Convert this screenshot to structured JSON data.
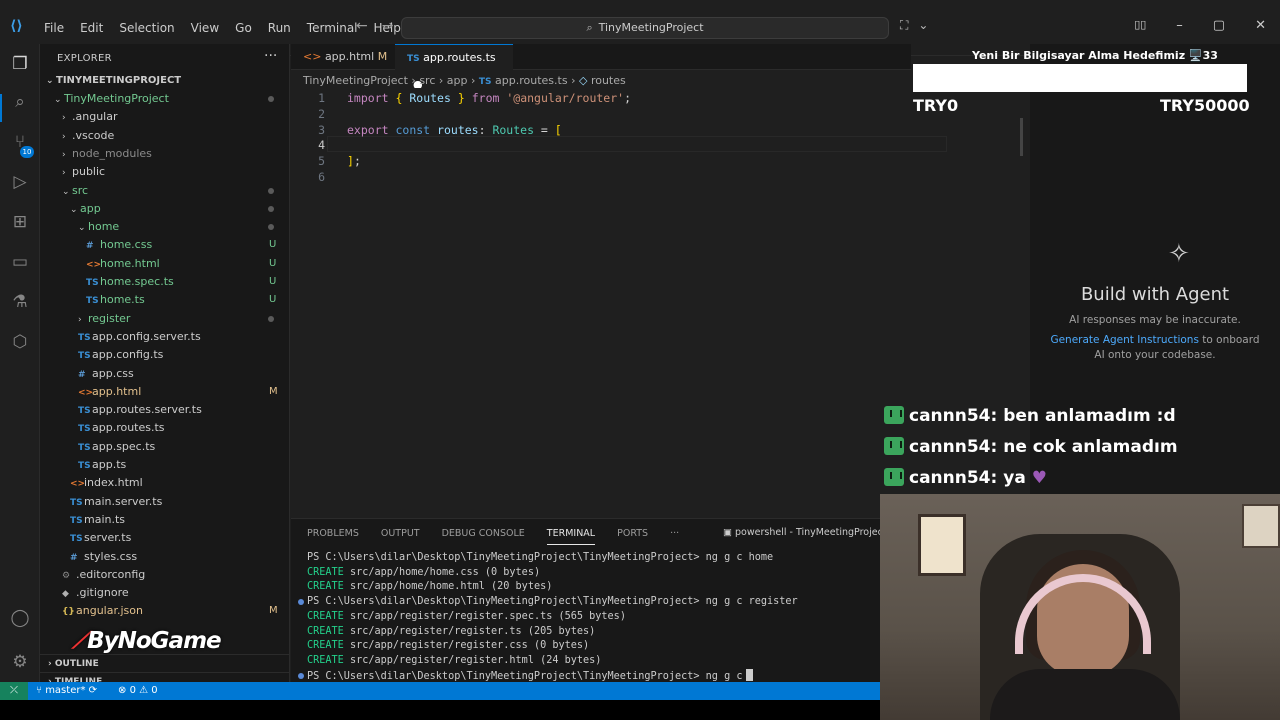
{
  "titlebar": {
    "menu": [
      "File",
      "Edit",
      "Selection",
      "View",
      "Go",
      "Run",
      "Terminal",
      "Help"
    ],
    "search": "TinyMeetingProject"
  },
  "sidebar": {
    "header": "EXPLORER",
    "project": "TINYMEETINGPROJECT",
    "items": [
      {
        "label": "TinyMeetingProject",
        "type": "folder",
        "open": true,
        "depth": 1,
        "icon": "",
        "status": "dot"
      },
      {
        "label": ".angular",
        "type": "folder",
        "open": false,
        "depth": 2,
        "icon": "",
        "status": ""
      },
      {
        "label": ".vscode",
        "type": "folder",
        "open": false,
        "depth": 2,
        "icon": "",
        "status": ""
      },
      {
        "label": "node_modules",
        "type": "folder",
        "open": false,
        "depth": 2,
        "icon": "",
        "status": "",
        "dim": true
      },
      {
        "label": "public",
        "type": "folder",
        "open": false,
        "depth": 2,
        "icon": "",
        "status": ""
      },
      {
        "label": "src",
        "type": "folder",
        "open": true,
        "depth": 2,
        "icon": "",
        "status": "dot"
      },
      {
        "label": "app",
        "type": "folder",
        "open": true,
        "depth": 3,
        "icon": "",
        "status": "dot"
      },
      {
        "label": "home",
        "type": "folder",
        "open": true,
        "depth": 4,
        "icon": "",
        "status": "dot"
      },
      {
        "label": "home.css",
        "type": "file",
        "depth": 5,
        "icon": "#",
        "kind": "css",
        "status": "U"
      },
      {
        "label": "home.html",
        "type": "file",
        "depth": 5,
        "icon": "<>",
        "kind": "htm",
        "status": "U"
      },
      {
        "label": "home.spec.ts",
        "type": "file",
        "depth": 5,
        "icon": "TS",
        "kind": "ts",
        "status": "U"
      },
      {
        "label": "home.ts",
        "type": "file",
        "depth": 5,
        "icon": "TS",
        "kind": "ts",
        "status": "U"
      },
      {
        "label": "register",
        "type": "folder",
        "open": false,
        "depth": 4,
        "icon": "",
        "status": "dot"
      },
      {
        "label": "app.config.server.ts",
        "type": "file",
        "depth": 4,
        "icon": "TS",
        "kind": "ts",
        "status": ""
      },
      {
        "label": "app.config.ts",
        "type": "file",
        "depth": 4,
        "icon": "TS",
        "kind": "ts",
        "status": ""
      },
      {
        "label": "app.css",
        "type": "file",
        "depth": 4,
        "icon": "#",
        "kind": "css",
        "status": ""
      },
      {
        "label": "app.html",
        "type": "file",
        "depth": 4,
        "icon": "<>",
        "kind": "htm",
        "status": "M"
      },
      {
        "label": "app.routes.server.ts",
        "type": "file",
        "depth": 4,
        "icon": "TS",
        "kind": "ts",
        "status": ""
      },
      {
        "label": "app.routes.ts",
        "type": "file",
        "depth": 4,
        "icon": "TS",
        "kind": "ts",
        "status": ""
      },
      {
        "label": "app.spec.ts",
        "type": "file",
        "depth": 4,
        "icon": "TS",
        "kind": "ts",
        "status": ""
      },
      {
        "label": "app.ts",
        "type": "file",
        "depth": 4,
        "icon": "TS",
        "kind": "ts",
        "status": ""
      },
      {
        "label": "index.html",
        "type": "file",
        "depth": 3,
        "icon": "<>",
        "kind": "htm",
        "status": ""
      },
      {
        "label": "main.server.ts",
        "type": "file",
        "depth": 3,
        "icon": "TS",
        "kind": "ts",
        "status": ""
      },
      {
        "label": "main.ts",
        "type": "file",
        "depth": 3,
        "icon": "TS",
        "kind": "ts",
        "status": ""
      },
      {
        "label": "server.ts",
        "type": "file",
        "depth": 3,
        "icon": "TS",
        "kind": "ts",
        "status": ""
      },
      {
        "label": "styles.css",
        "type": "file",
        "depth": 3,
        "icon": "#",
        "kind": "css",
        "status": ""
      },
      {
        "label": ".editorconfig",
        "type": "file",
        "depth": 2,
        "icon": "⚙",
        "kind": "gear",
        "status": ""
      },
      {
        "label": ".gitignore",
        "type": "file",
        "depth": 2,
        "icon": "◆",
        "kind": "git",
        "status": ""
      },
      {
        "label": "angular.json",
        "type": "file",
        "depth": 2,
        "icon": "{}",
        "kind": "json",
        "status": "M"
      }
    ],
    "outline": "OUTLINE",
    "timeline": "TIMELINE"
  },
  "tabs": [
    {
      "label": "app.html",
      "modified": "M",
      "active": false
    },
    {
      "label": "app.routes.ts",
      "modified": "●",
      "active": true
    }
  ],
  "breadcrumb": [
    "TinyMeetingProject",
    "src",
    "app",
    "app.routes.ts",
    "routes"
  ],
  "editor": {
    "line_numbers": [
      "1",
      "2",
      "3",
      "4",
      "5",
      "6"
    ],
    "current_line": 4
  },
  "agent": {
    "title": "Build with Agent",
    "subtitle": "AI responses may be inaccurate.",
    "link": "Generate Agent Instructions",
    "link_rest": "to onboard AI onto your codebase."
  },
  "stream": {
    "goal_title": "Yeni Bir Bilgisayar Alma Hedefimiz 🖥️33",
    "goal_min": "TRY0",
    "goal_max": "TRY50000",
    "chat": [
      {
        "user": "cannn54",
        "msg": "ben anlamadım :d"
      },
      {
        "user": "cannn54",
        "msg": "ne cok anlamadım"
      },
      {
        "user": "cannn54",
        "msg": "ya"
      }
    ],
    "logo": "ByNoGame"
  },
  "panel": {
    "tabs": [
      "PROBLEMS",
      "OUTPUT",
      "DEBUG CONSOLE",
      "TERMINAL",
      "PORTS"
    ],
    "active_tab": "TERMINAL",
    "shell": "powershell - TinyMeetingProject",
    "lines": [
      {
        "kind": "prompt",
        "text": "PS C:\\Users\\dilar\\Desktop\\TinyMeetingProject\\TinyMeetingProject> ng g c home"
      },
      {
        "kind": "create",
        "text": " src/app/home/home.css (0 bytes)"
      },
      {
        "kind": "create",
        "text": " src/app/home/home.html (20 bytes)"
      },
      {
        "kind": "prompt",
        "text": "PS C:\\Users\\dilar\\Desktop\\TinyMeetingProject\\TinyMeetingProject> ng g c register",
        "dot": true
      },
      {
        "kind": "create",
        "text": " src/app/register/register.spec.ts (565 bytes)"
      },
      {
        "kind": "create",
        "text": " src/app/register/register.ts (205 bytes)"
      },
      {
        "kind": "create",
        "text": " src/app/register/register.css (0 bytes)"
      },
      {
        "kind": "create",
        "text": " src/app/register/register.html (24 bytes)"
      },
      {
        "kind": "prompt",
        "text": "PS C:\\Users\\dilar\\Desktop\\TinyMeetingProject\\TinyMeetingProject> ng g c",
        "dot": true,
        "cursor": true
      }
    ],
    "create_label": "CREATE"
  },
  "status": {
    "branch": "master*",
    "errors": "0",
    "warnings": "0"
  },
  "colors": {
    "accent": "#0078d4",
    "status_bar": "#0078d4",
    "create": "#23d18b"
  }
}
